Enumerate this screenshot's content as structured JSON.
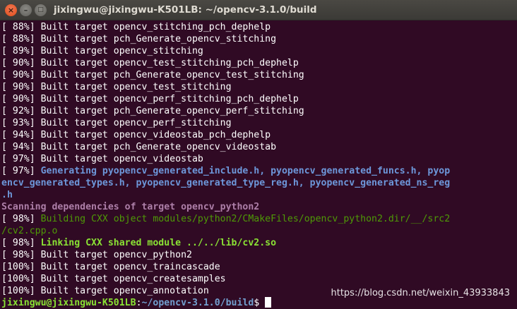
{
  "window": {
    "title": "jixingwu@jixingwu-K501LB: ~/opencv-3.1.0/build",
    "close_glyph": "×",
    "min_glyph": "–",
    "max_glyph": "□"
  },
  "terminal": {
    "lines": [
      {
        "text": "[ 88%] Built target opencv_stitching_pch_dephelp",
        "style": "white"
      },
      {
        "text": "[ 88%] Built target pch_Generate_opencv_stitching",
        "style": "white"
      },
      {
        "text": "[ 89%] Built target opencv_stitching",
        "style": "white"
      },
      {
        "text": "[ 90%] Built target opencv_test_stitching_pch_dephelp",
        "style": "white"
      },
      {
        "text": "[ 90%] Built target pch_Generate_opencv_test_stitching",
        "style": "white"
      },
      {
        "text": "[ 90%] Built target opencv_test_stitching",
        "style": "white"
      },
      {
        "text": "[ 90%] Built target opencv_perf_stitching_pch_dephelp",
        "style": "white"
      },
      {
        "text": "[ 92%] Built target pch_Generate_opencv_perf_stitching",
        "style": "white"
      },
      {
        "text": "[ 93%] Built target opencv_perf_stitching",
        "style": "white"
      },
      {
        "text": "[ 94%] Built target opencv_videostab_pch_dephelp",
        "style": "white"
      },
      {
        "text": "[ 94%] Built target pch_Generate_opencv_videostab",
        "style": "white"
      },
      {
        "text": "[ 97%] Built target opencv_videostab",
        "style": "white"
      },
      {
        "prefix": "[ 97%] ",
        "text": "Generating pyopencv_generated_include.h, pyopencv_generated_funcs.h, pyop",
        "style": "blue"
      },
      {
        "text": "encv_generated_types.h, pyopencv_generated_type_reg.h, pyopencv_generated_ns_reg",
        "style": "blue"
      },
      {
        "text": ".h",
        "style": "blue"
      },
      {
        "text": "Scanning dependencies of target opencv_python2",
        "style": "magenta"
      },
      {
        "prefix": "[ 98%] ",
        "text": "Building CXX object modules/python2/CMakeFiles/opencv_python2.dir/__/src2",
        "style": "green"
      },
      {
        "text": "/cv2.cpp.o",
        "style": "green"
      },
      {
        "prefix": "[ 98%] ",
        "text": "Linking CXX shared module ../../lib/cv2.so",
        "style": "bgreen"
      },
      {
        "text": "[ 98%] Built target opencv_python2",
        "style": "white"
      },
      {
        "text": "[100%] Built target opencv_traincascade",
        "style": "white"
      },
      {
        "text": "[100%] Built target opencv_createsamples",
        "style": "white"
      },
      {
        "text": "[100%] Built target opencv_annotation",
        "style": "white"
      }
    ],
    "prompt": {
      "user_host": "jixingwu@jixingwu-K501LB",
      "separator": ":",
      "path": "~/opencv-3.1.0/build",
      "symbol": "$"
    }
  },
  "watermark": "https://blog.csdn.net/weixin_43933843",
  "colors": {
    "background": "#300a24",
    "blue": "#6d97da",
    "magenta": "#ad7fa8",
    "green": "#4e9a06",
    "bright_green": "#8ae234"
  }
}
